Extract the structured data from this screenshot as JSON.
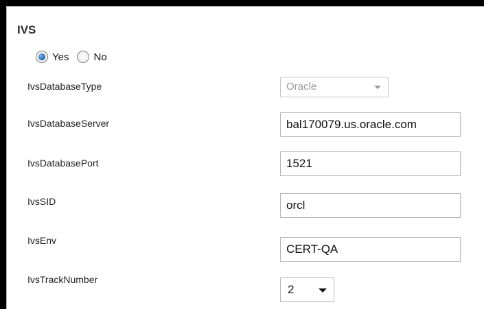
{
  "section": {
    "title": "IVS"
  },
  "ivs_enabled": {
    "options": [
      {
        "label": "Yes",
        "checked": true
      },
      {
        "label": "No",
        "checked": false
      }
    ]
  },
  "fields": {
    "database_type": {
      "label": "IvsDatabaseType",
      "value": "Oracle",
      "disabled": true
    },
    "database_server": {
      "label": "IvsDatabaseServer",
      "value": "bal170079.us.oracle.com"
    },
    "database_port": {
      "label": "IvsDatabasePort",
      "value": "1521"
    },
    "sid": {
      "label": "IvsSID",
      "value": "orcl"
    },
    "env": {
      "label": "IvsEnv",
      "value": "CERT-QA"
    },
    "track_number": {
      "label": "IvsTrackNumber",
      "value": "2"
    }
  },
  "colors": {
    "frame": "#000000",
    "panel_bg": "#ffffff",
    "radio_accent": "#1f5fa6",
    "disabled_text": "#9a9a9a"
  }
}
